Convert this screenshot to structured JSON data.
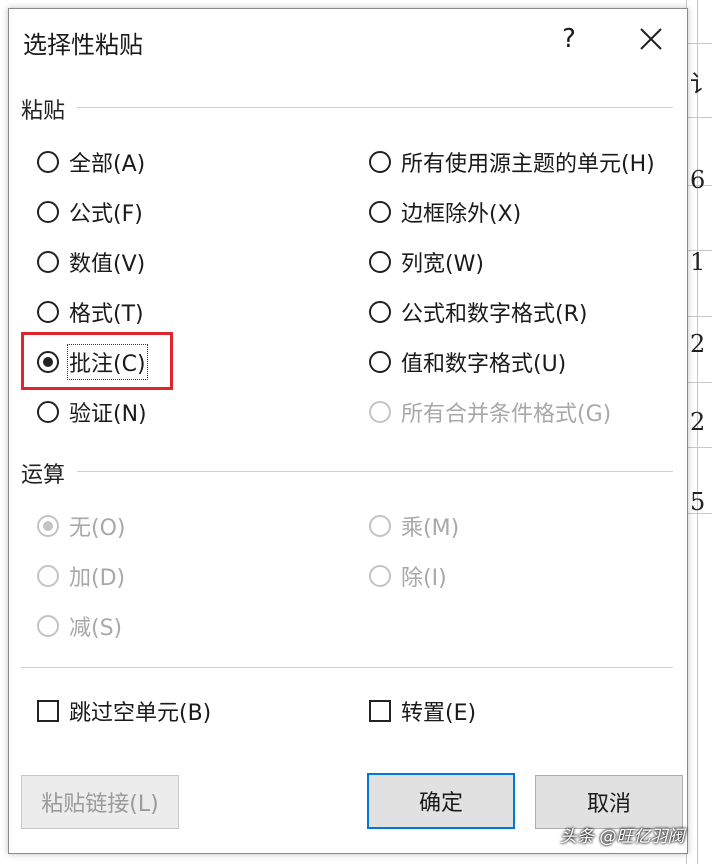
{
  "spreadsheet": {
    "peek_chars": [
      "讠",
      "6",
      "1",
      "2",
      "2",
      "5"
    ]
  },
  "dialog": {
    "title": "选择性粘贴",
    "help_glyph": "?",
    "paste_section_label": "粘贴",
    "paste_options_left": [
      {
        "label": "全部(A)",
        "checked": false
      },
      {
        "label": "公式(F)",
        "checked": false
      },
      {
        "label": "数值(V)",
        "checked": false
      },
      {
        "label": "格式(T)",
        "checked": false
      },
      {
        "label": "批注(C)",
        "checked": true
      },
      {
        "label": "验证(N)",
        "checked": false
      }
    ],
    "paste_options_right": [
      {
        "label": "所有使用源主题的单元(H)",
        "checked": false,
        "enabled": true
      },
      {
        "label": "边框除外(X)",
        "checked": false,
        "enabled": true
      },
      {
        "label": "列宽(W)",
        "checked": false,
        "enabled": true
      },
      {
        "label": "公式和数字格式(R)",
        "checked": false,
        "enabled": true
      },
      {
        "label": "值和数字格式(U)",
        "checked": false,
        "enabled": true
      },
      {
        "label": "所有合并条件格式(G)",
        "checked": false,
        "enabled": false
      }
    ],
    "operation_section_label": "运算",
    "operation_options": [
      {
        "label": "无(O)",
        "checked": true
      },
      {
        "label": "加(D)",
        "checked": false
      },
      {
        "label": "减(S)",
        "checked": false
      },
      {
        "label": "乘(M)",
        "checked": false
      },
      {
        "label": "除(I)",
        "checked": false
      }
    ],
    "skip_blanks_label": "跳过空单元(B)",
    "transpose_label": "转置(E)",
    "paste_link_label": "粘贴链接(L)",
    "ok_label": "确定",
    "cancel_label": "取消"
  },
  "watermark": "头条 @旺亿羽阀",
  "colors": {
    "highlight": "#e0262b",
    "default_button_border": "#0078d7",
    "disabled_text": "#a8a8a8"
  }
}
